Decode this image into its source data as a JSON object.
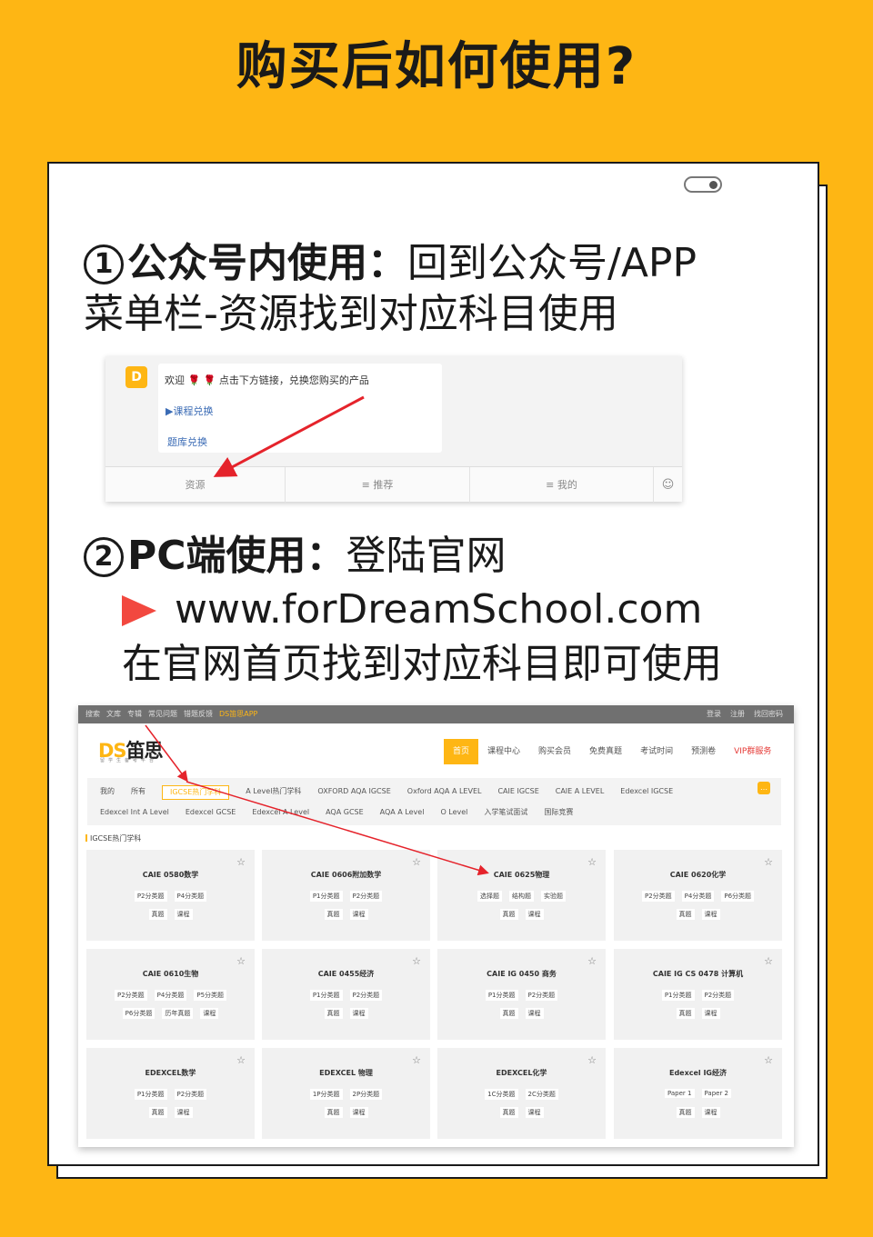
{
  "headline": "购买后如何使用?",
  "step1": {
    "num": "1",
    "title": "公众号内使用：",
    "desc_a": "回到公众号/APP",
    "desc_b": "菜单栏-资源找到对应科目使用"
  },
  "wechat": {
    "avatar": "D",
    "greeting_a": "欢迎",
    "rose": "🌹",
    "greeting_b": "点击下方链接，兑换您购买的产品",
    "link1": "▶课程兑换",
    "link2": "题库兑换",
    "menu": [
      "资源",
      "≡ 推荐",
      "≡ 我的"
    ],
    "keyboard_icon": "☺"
  },
  "step2": {
    "num": "2",
    "title": "PC端使用：",
    "desc": "登陆官网",
    "url": "www.forDreamSchool.com",
    "tail": "在官网首页找到对应科目即可使用"
  },
  "site": {
    "topbar_left": [
      "搜索",
      "文库",
      "专辑",
      "常见问题",
      "错题反馈"
    ],
    "topbar_app": "DS笛思APP",
    "topbar_right": [
      "登录",
      "注册",
      "找回密码"
    ],
    "logo_ds": "DS",
    "logo_cn": "笛思",
    "logo_sub": "留学生备考平台",
    "nav": [
      "首页",
      "课程中心",
      "购买会员",
      "免费真题",
      "考试时间",
      "预测卷",
      "VIP群服务"
    ],
    "subjects_row1": [
      "我的",
      "所有",
      "IGCSE热门学科",
      "A Level热门学科",
      "OXFORD AQA IGCSE",
      "Oxford AQA A LEVEL",
      "CAIE IGCSE",
      "CAIE A LEVEL",
      "Edexcel IGCSE"
    ],
    "subjects_row2": [
      "Edexcel Int A Level",
      "Edexcel GCSE",
      "Edexcel A Level",
      "AQA GCSE",
      "AQA A Level",
      "O Level",
      "入学笔试面试",
      "国际竞赛"
    ],
    "chat_icon": "…",
    "section_title": "IGCSE热门学科",
    "tiles": [
      {
        "title": "CAIE 0580数学",
        "a": [
          "P2分类题",
          "P4分类题"
        ],
        "b": [
          "真题",
          "课程"
        ]
      },
      {
        "title": "CAIE 0606附加数学",
        "a": [
          "P1分类题",
          "P2分类题"
        ],
        "b": [
          "真题",
          "课程"
        ]
      },
      {
        "title": "CAIE 0625物理",
        "a": [
          "选择题",
          "结构题",
          "实验题"
        ],
        "b": [
          "真题",
          "课程"
        ]
      },
      {
        "title": "CAIE 0620化学",
        "a": [
          "P2分类题",
          "P4分类题",
          "P6分类题"
        ],
        "b": [
          "真题",
          "课程"
        ]
      },
      {
        "title": "CAIE 0610生物",
        "a": [
          "P2分类题",
          "P4分类题",
          "P5分类题"
        ],
        "b": [
          "P6分类题",
          "历年真题",
          "课程"
        ]
      },
      {
        "title": "CAIE 0455经济",
        "a": [
          "P1分类题",
          "P2分类题"
        ],
        "b": [
          "真题",
          "课程"
        ]
      },
      {
        "title": "CAIE IG 0450 商务",
        "a": [
          "P1分类题",
          "P2分类题"
        ],
        "b": [
          "真题",
          "课程"
        ]
      },
      {
        "title": "CAIE IG CS 0478 计算机",
        "a": [
          "P1分类题",
          "P2分类题"
        ],
        "b": [
          "真题",
          "课程"
        ]
      },
      {
        "title": "EDEXCEL数学",
        "a": [
          "P1分类题",
          "P2分类题"
        ],
        "b": [
          "真题",
          "课程"
        ]
      },
      {
        "title": "EDEXCEL 物理",
        "a": [
          "1P分类题",
          "2P分类题"
        ],
        "b": [
          "真题",
          "课程"
        ]
      },
      {
        "title": "EDEXCEL化学",
        "a": [
          "1C分类题",
          "2C分类题"
        ],
        "b": [
          "真题",
          "课程"
        ]
      },
      {
        "title": "Edexcel IG经济",
        "a": [
          "Paper 1",
          "Paper 2"
        ],
        "b": [
          "真题",
          "课程"
        ]
      }
    ]
  },
  "colors": {
    "accent": "#FEB614",
    "arrow": "#E5232B",
    "link": "#3A6BB5"
  },
  "icons": {
    "star": "☆"
  }
}
